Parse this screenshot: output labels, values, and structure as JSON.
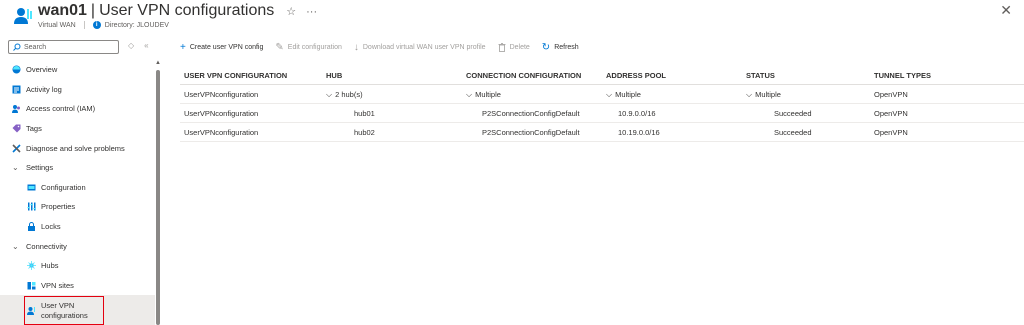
{
  "header": {
    "resource_name": "wan01",
    "separator": "|",
    "page_title": "User VPN configurations",
    "resource_type": "Virtual WAN",
    "directory": "Directory: JLOUDEV"
  },
  "sidebar": {
    "search_placeholder": "Search",
    "items": [
      {
        "label": "Overview",
        "icon": "overview-icon"
      },
      {
        "label": "Activity log",
        "icon": "activity-log-icon"
      },
      {
        "label": "Access control (IAM)",
        "icon": "iam-icon"
      },
      {
        "label": "Tags",
        "icon": "tag-icon"
      },
      {
        "label": "Diagnose and solve problems",
        "icon": "wrench-icon"
      },
      {
        "label": "Settings",
        "group": true
      },
      {
        "label": "Configuration",
        "icon": "configuration-icon"
      },
      {
        "label": "Properties",
        "icon": "properties-icon"
      },
      {
        "label": "Locks",
        "icon": "lock-icon"
      },
      {
        "label": "Connectivity",
        "group": true
      },
      {
        "label": "Hubs",
        "icon": "hub-icon"
      },
      {
        "label": "VPN sites",
        "icon": "vpn-sites-icon"
      },
      {
        "label_line1": "User VPN",
        "label_line2": "configurations",
        "icon": "user-vpn-icon",
        "selected": true
      }
    ]
  },
  "toolbar": {
    "create": "Create user VPN config",
    "edit": "Edit configuration",
    "download": "Download virtual WAN user VPN profile",
    "delete": "Delete",
    "refresh": "Refresh"
  },
  "table": {
    "headers": [
      "USER VPN CONFIGURATION",
      "HUB",
      "CONNECTION CONFIGURATION",
      "ADDRESS POOL",
      "STATUS",
      "TUNNEL TYPES"
    ],
    "group_row": [
      "UserVPNconfiguration",
      "2 hub(s)",
      "Multiple",
      "Multiple",
      "Multiple",
      "OpenVPN"
    ],
    "rows": [
      [
        "UserVPNconfiguration",
        "hub01",
        "P2SConnectionConfigDefault",
        "10.9.0.0/16",
        "Succeeded",
        "OpenVPN"
      ],
      [
        "UserVPNconfiguration",
        "hub02",
        "P2SConnectionConfigDefault",
        "10.19.0.0/16",
        "Succeeded",
        "OpenVPN"
      ]
    ]
  },
  "colors": {
    "accent": "#0078d4",
    "selection_border": "#e3000f",
    "selected_bg": "#edebe9"
  }
}
